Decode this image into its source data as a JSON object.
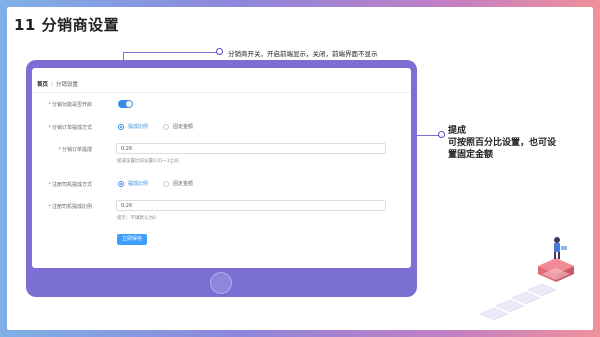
{
  "slide": {
    "title": "11 分销商设置"
  },
  "callout_top": "分销商开关，开启前端显示，关闭，前端界面不显示",
  "callout_right": {
    "line1": "提成",
    "line2": "可按照百分比设置，也可设",
    "line3": "置固定金额"
  },
  "breadcrumb": {
    "home": "首页",
    "sep": "/",
    "current": "分销设置"
  },
  "form": {
    "enable_label": "分销功能是否开启",
    "order_mode_label": "分销订单提成方式",
    "order_mode_options": [
      "提成比例",
      "固定金额"
    ],
    "order_rate_label": "分销订单提成",
    "order_rate_value": "0.26",
    "order_rate_hint": "提成设置比较设置0.01~1之间",
    "driver_mode_label": "注册司机提成方式",
    "driver_mode_options": [
      "提成比例",
      "固定金额"
    ],
    "driver_rate_label": "注册司机提成比例",
    "driver_rate_value": "0.26",
    "driver_rate_hint": "提示：不填默认为0",
    "save_label": "立即保存"
  },
  "colors": {
    "accent": "#409eff",
    "tablet": "#7b6fd4"
  }
}
